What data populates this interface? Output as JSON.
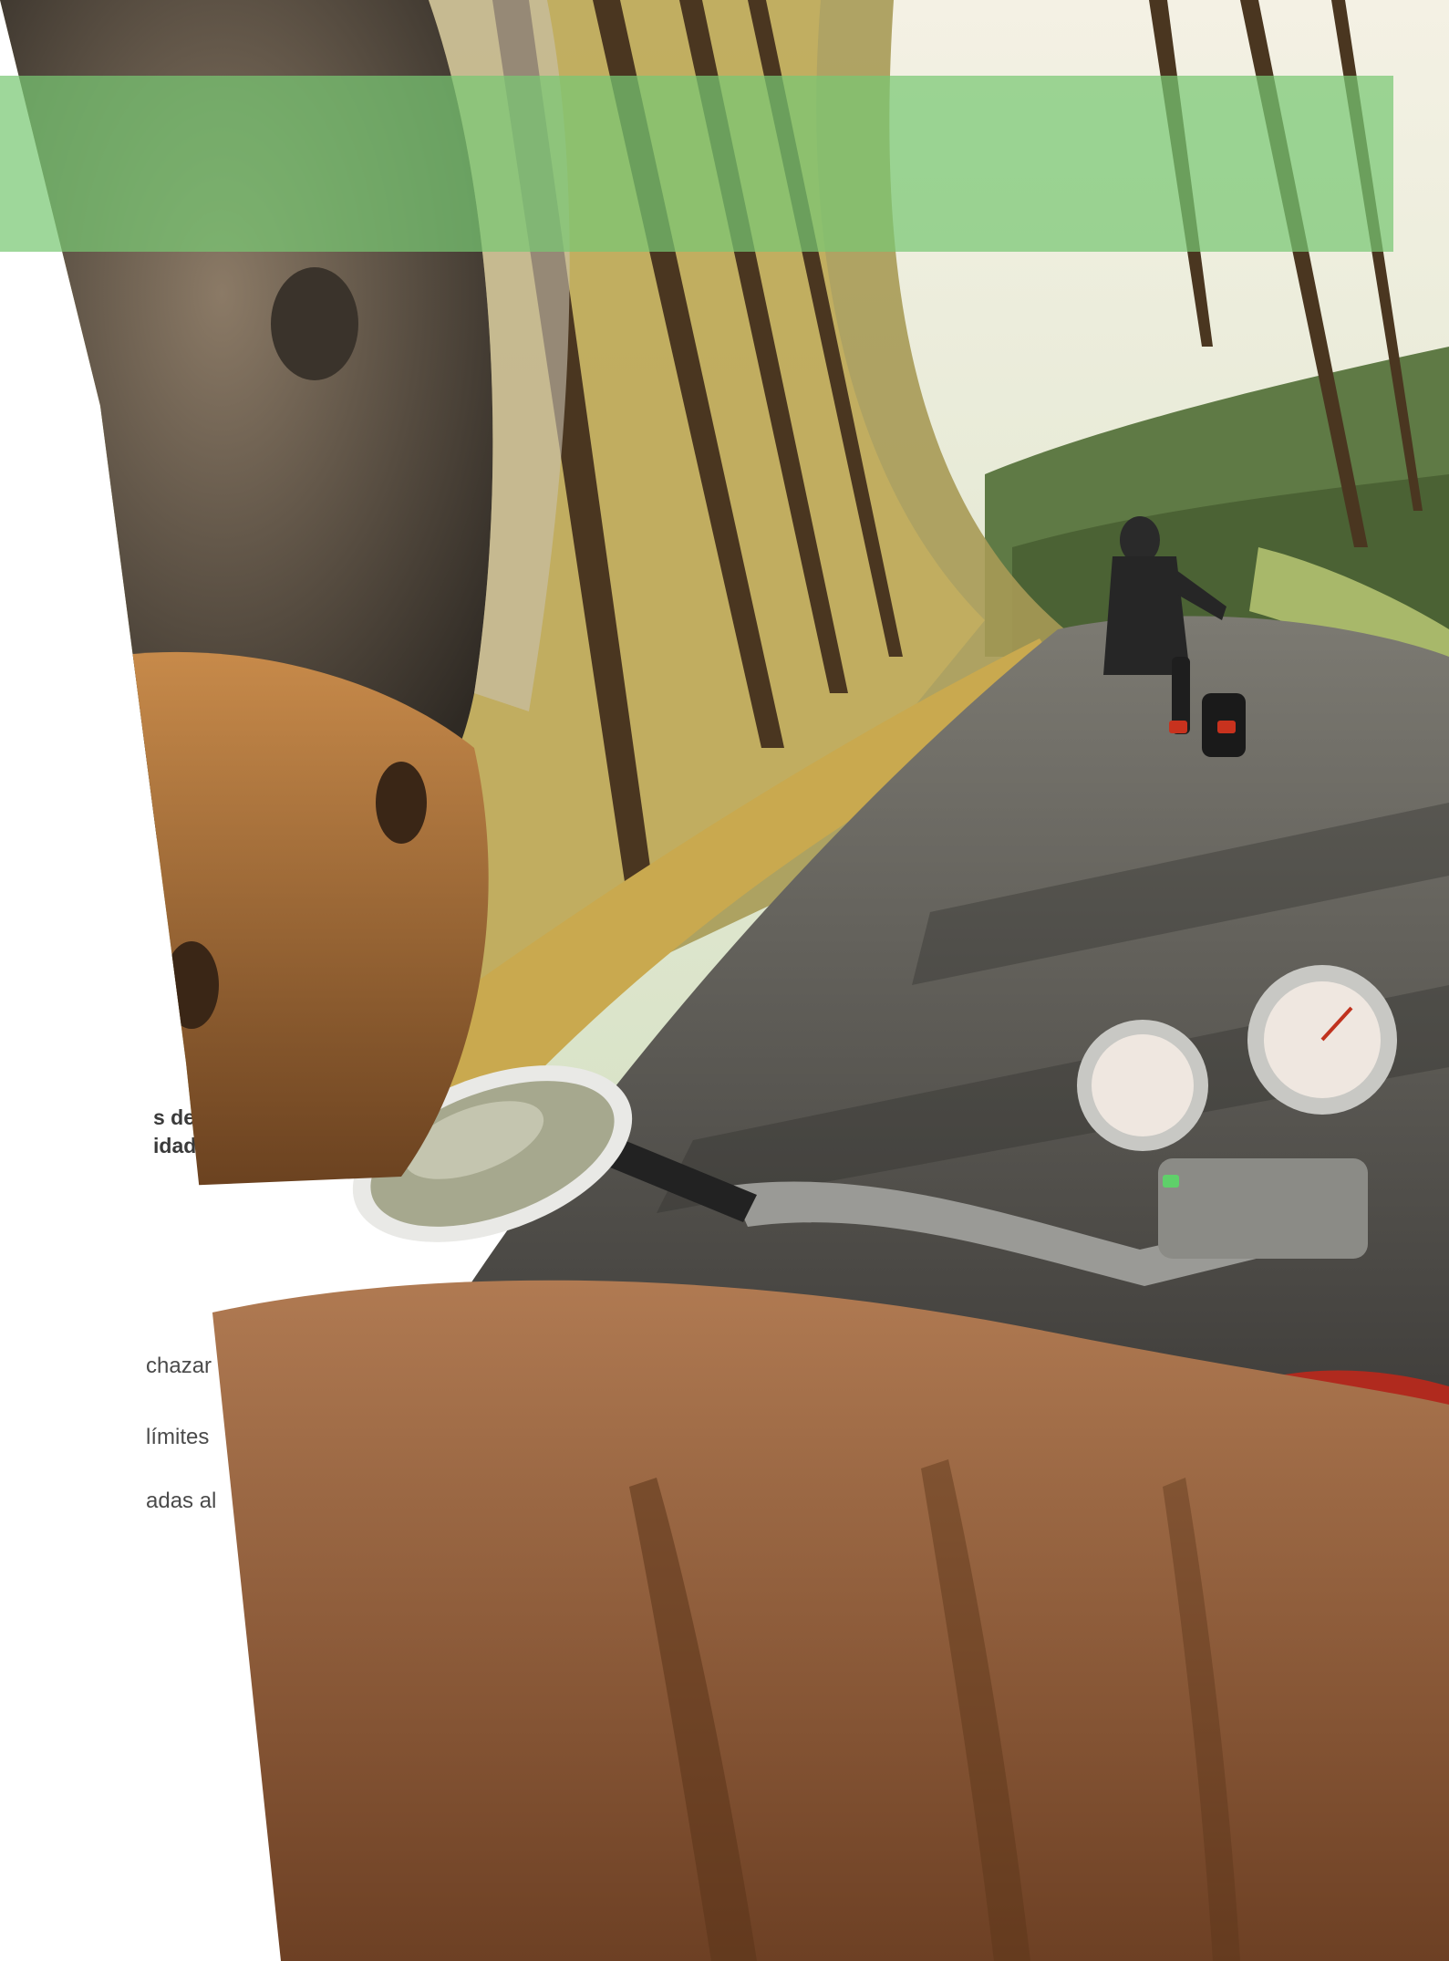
{
  "text_fragments": {
    "bold_lines": [
      "s del",
      "idad"
    ],
    "body_lines": [
      "chazar",
      "límites",
      "adas al"
    ]
  },
  "colors": {
    "band_green": "#78c873",
    "text_dark": "#3a3a3a",
    "text_body": "#4a4a4a"
  }
}
